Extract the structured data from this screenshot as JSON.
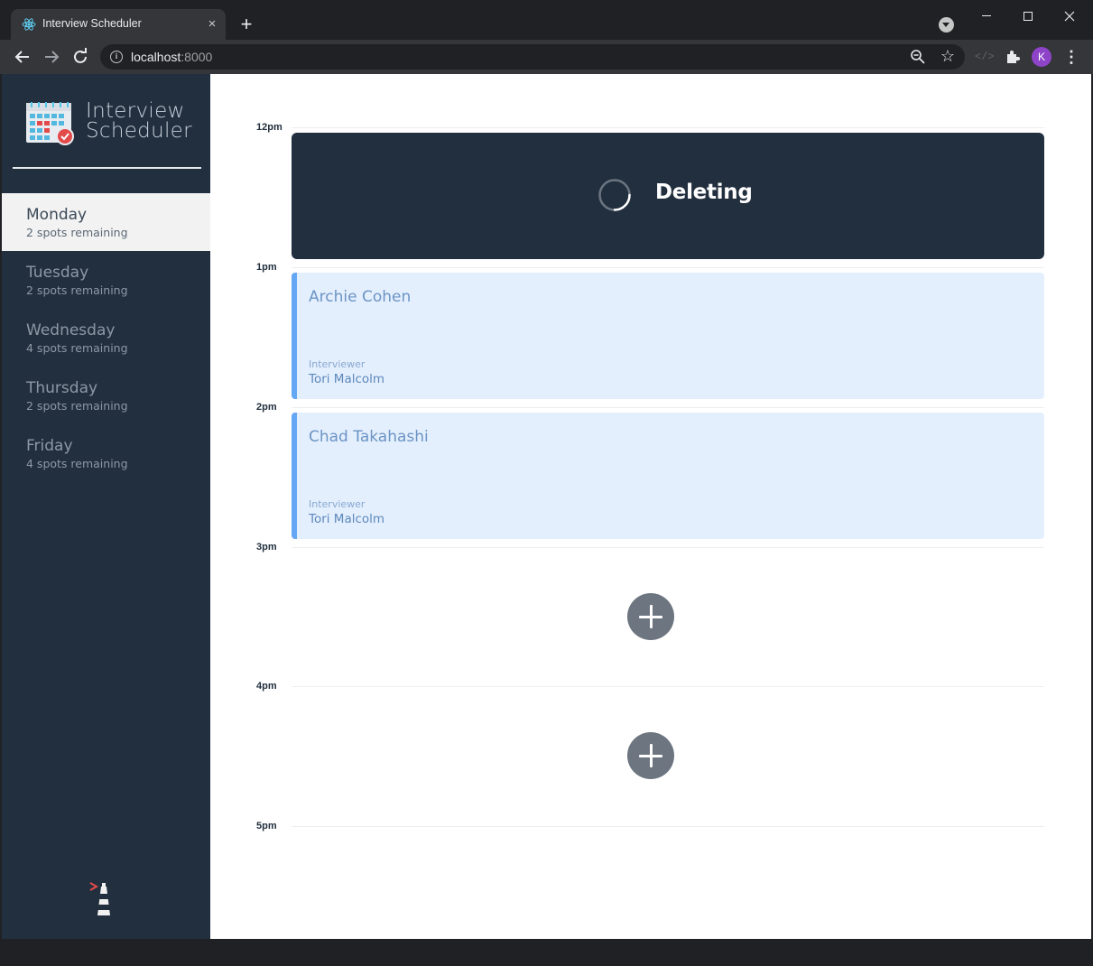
{
  "browser": {
    "tab_title": "Interview Scheduler",
    "tab_close": "×",
    "new_tab": "+",
    "url_host": "localhost",
    "url_port": ":8000",
    "profile_initial": "K",
    "menu": "⋮",
    "devtools": "</>",
    "star": "☆"
  },
  "sidebar": {
    "logo_line1": "Interview",
    "logo_line2": "Scheduler",
    "days": [
      {
        "name": "Monday",
        "spots": "2 spots remaining",
        "selected": true
      },
      {
        "name": "Tuesday",
        "spots": "2 spots remaining",
        "selected": false
      },
      {
        "name": "Wednesday",
        "spots": "4 spots remaining",
        "selected": false
      },
      {
        "name": "Thursday",
        "spots": "2 spots remaining",
        "selected": false
      },
      {
        "name": "Friday",
        "spots": "4 spots remaining",
        "selected": false
      }
    ]
  },
  "schedule": {
    "times": [
      "12pm",
      "1pm",
      "2pm",
      "3pm",
      "4pm",
      "5pm"
    ],
    "status_text": "Deleting",
    "appointments": [
      {
        "student": "Archie Cohen",
        "interviewer_label": "Interviewer",
        "interviewer": "Tori Malcolm"
      },
      {
        "student": "Chad Takahashi",
        "interviewer_label": "Interviewer",
        "interviewer": "Tori Malcolm"
      }
    ]
  },
  "colors": {
    "sidebar_bg": "#222f3e",
    "appointment_bg": "#e4effe",
    "appointment_accent": "#64a7f4",
    "add_button": "#6d7580"
  }
}
